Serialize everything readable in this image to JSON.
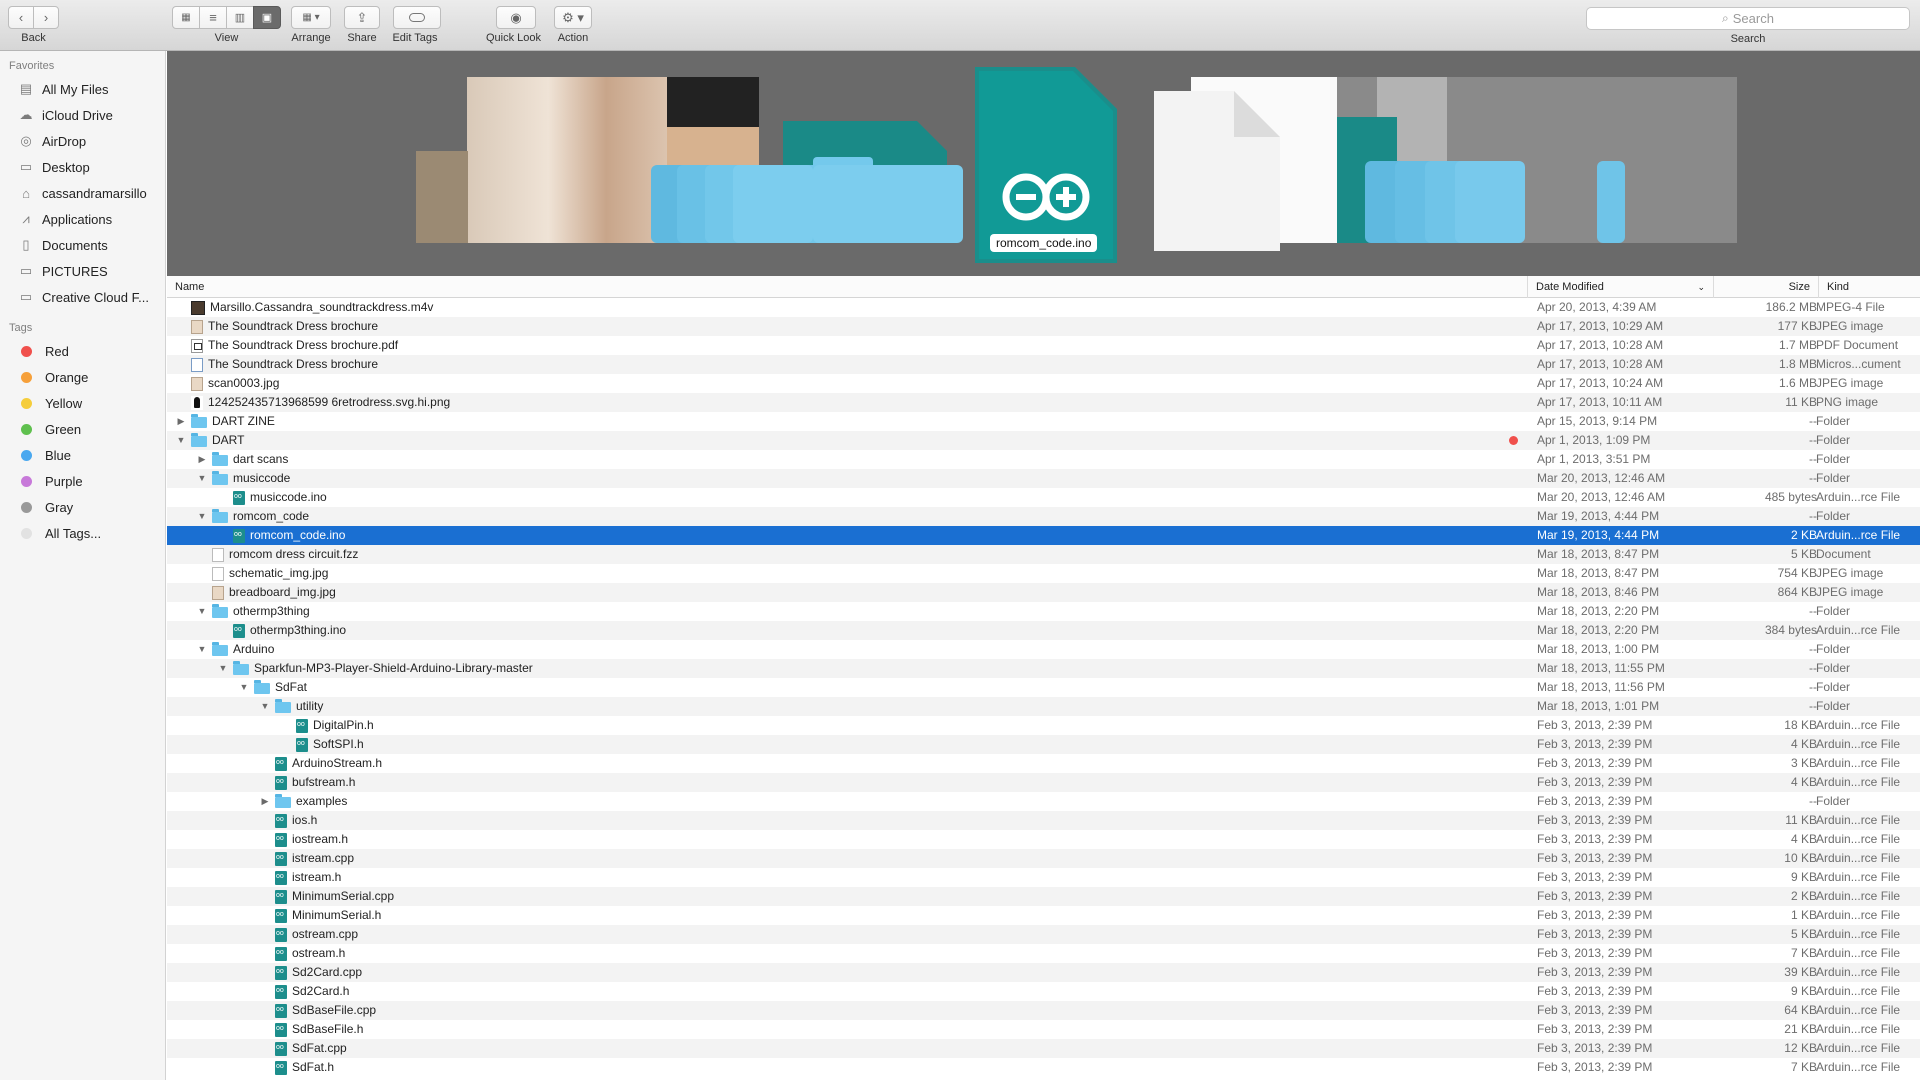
{
  "toolbar": {
    "back_label": "Back",
    "view_label": "View",
    "arrange_label": "Arrange",
    "share_label": "Share",
    "edit_tags_label": "Edit Tags",
    "quick_look_label": "Quick Look",
    "action_label": "Action",
    "search_placeholder": "Search",
    "search_label": "Search"
  },
  "sidebar": {
    "favorites_header": "Favorites",
    "favorites": [
      {
        "label": "All My Files",
        "icon": "all-files-icon"
      },
      {
        "label": "iCloud Drive",
        "icon": "cloud-icon"
      },
      {
        "label": "AirDrop",
        "icon": "airdrop-icon"
      },
      {
        "label": "Desktop",
        "icon": "desktop-icon"
      },
      {
        "label": "cassandramarsillo",
        "icon": "home-icon"
      },
      {
        "label": "Applications",
        "icon": "applications-icon"
      },
      {
        "label": "Documents",
        "icon": "documents-icon"
      },
      {
        "label": "PICTURES",
        "icon": "folder-icon"
      },
      {
        "label": "Creative Cloud F...",
        "icon": "folder-icon"
      }
    ],
    "tags_header": "Tags",
    "tags": [
      {
        "label": "Red",
        "color": "#f0504c"
      },
      {
        "label": "Orange",
        "color": "#f6a03a"
      },
      {
        "label": "Yellow",
        "color": "#f5cd3b"
      },
      {
        "label": "Green",
        "color": "#5fc04e"
      },
      {
        "label": "Blue",
        "color": "#4aa8ef"
      },
      {
        "label": "Purple",
        "color": "#c779d9"
      },
      {
        "label": "Gray",
        "color": "#999999"
      },
      {
        "label": "All Tags...",
        "color": "#e2e2e2"
      }
    ]
  },
  "coverflow": {
    "selected_caption": "romcom_code.ino"
  },
  "list": {
    "columns": {
      "name": "Name",
      "date": "Date Modified",
      "size": "Size",
      "kind": "Kind"
    },
    "rows": [
      {
        "name": "Marsillo.Cassandra_soundtrackdress.m4v",
        "date": "Apr 20, 2013, 4:39 AM",
        "size": "186.2 MB",
        "kind": "MPEG-4 File",
        "icon": "video",
        "level": 0,
        "disc": ""
      },
      {
        "name": "The Soundtrack Dress brochure",
        "date": "Apr 17, 2013, 10:29 AM",
        "size": "177 KB",
        "kind": "JPEG image",
        "icon": "img",
        "level": 0,
        "disc": ""
      },
      {
        "name": "The Soundtrack Dress brochure.pdf",
        "date": "Apr 17, 2013, 10:28 AM",
        "size": "1.7 MB",
        "kind": "PDF Document",
        "icon": "pdf",
        "level": 0,
        "disc": ""
      },
      {
        "name": "The Soundtrack Dress brochure",
        "date": "Apr 17, 2013, 10:28 AM",
        "size": "1.8 MB",
        "kind": "Micros...cument",
        "icon": "word",
        "level": 0,
        "disc": ""
      },
      {
        "name": "scan0003.jpg",
        "date": "Apr 17, 2013, 10:24 AM",
        "size": "1.6 MB",
        "kind": "JPEG image",
        "icon": "img",
        "level": 0,
        "disc": ""
      },
      {
        "name": "124252435713968599 6retrodress.svg.hi.png",
        "date": "Apr 17, 2013, 10:11 AM",
        "size": "11 KB",
        "kind": "PNG image",
        "icon": "png",
        "level": 0,
        "disc": ""
      },
      {
        "name": "DART ZINE",
        "date": "Apr 15, 2013, 9:14 PM",
        "size": "--",
        "kind": "Folder",
        "icon": "folder",
        "level": 0,
        "disc": "right"
      },
      {
        "name": "DART",
        "date": "Apr 1, 2013, 1:09 PM",
        "size": "--",
        "kind": "Folder",
        "icon": "folder",
        "level": 0,
        "disc": "down",
        "tag": "red"
      },
      {
        "name": "dart scans",
        "date": "Apr 1, 2013, 3:51 PM",
        "size": "--",
        "kind": "Folder",
        "icon": "folder",
        "level": 1,
        "disc": "right"
      },
      {
        "name": "musiccode",
        "date": "Mar 20, 2013, 12:46 AM",
        "size": "--",
        "kind": "Folder",
        "icon": "folder",
        "level": 1,
        "disc": "down"
      },
      {
        "name": "musiccode.ino",
        "date": "Mar 20, 2013, 12:46 AM",
        "size": "485 bytes",
        "kind": "Arduin...rce File",
        "icon": "ino",
        "level": 2,
        "disc": ""
      },
      {
        "name": "romcom_code",
        "date": "Mar 19, 2013, 4:44 PM",
        "size": "--",
        "kind": "Folder",
        "icon": "folder",
        "level": 1,
        "disc": "down"
      },
      {
        "name": "romcom_code.ino",
        "date": "Mar 19, 2013, 4:44 PM",
        "size": "2 KB",
        "kind": "Arduin...rce File",
        "icon": "ino",
        "level": 2,
        "disc": "",
        "selected": true
      },
      {
        "name": "romcom dress circuit.fzz",
        "date": "Mar 18, 2013, 8:47 PM",
        "size": "5 KB",
        "kind": "Document",
        "icon": "doc",
        "level": 1,
        "disc": ""
      },
      {
        "name": "schematic_img.jpg",
        "date": "Mar 18, 2013, 8:47 PM",
        "size": "754 KB",
        "kind": "JPEG image",
        "icon": "doc",
        "level": 1,
        "disc": ""
      },
      {
        "name": "breadboard_img.jpg",
        "date": "Mar 18, 2013, 8:46 PM",
        "size": "864 KB",
        "kind": "JPEG image",
        "icon": "img",
        "level": 1,
        "disc": ""
      },
      {
        "name": "othermp3thing",
        "date": "Mar 18, 2013, 2:20 PM",
        "size": "--",
        "kind": "Folder",
        "icon": "folder",
        "level": 1,
        "disc": "down"
      },
      {
        "name": "othermp3thing.ino",
        "date": "Mar 18, 2013, 2:20 PM",
        "size": "384 bytes",
        "kind": "Arduin...rce File",
        "icon": "ino",
        "level": 2,
        "disc": ""
      },
      {
        "name": "Arduino",
        "date": "Mar 18, 2013, 1:00 PM",
        "size": "--",
        "kind": "Folder",
        "icon": "folder",
        "level": 1,
        "disc": "down"
      },
      {
        "name": "Sparkfun-MP3-Player-Shield-Arduino-Library-master",
        "date": "Mar 18, 2013, 11:55 PM",
        "size": "--",
        "kind": "Folder",
        "icon": "folder",
        "level": 2,
        "disc": "down"
      },
      {
        "name": "SdFat",
        "date": "Mar 18, 2013, 11:56 PM",
        "size": "--",
        "kind": "Folder",
        "icon": "folder",
        "level": 3,
        "disc": "down"
      },
      {
        "name": "utility",
        "date": "Mar 18, 2013, 1:01 PM",
        "size": "--",
        "kind": "Folder",
        "icon": "folder",
        "level": 4,
        "disc": "down"
      },
      {
        "name": "DigitalPin.h",
        "date": "Feb 3, 2013, 2:39 PM",
        "size": "18 KB",
        "kind": "Arduin...rce File",
        "icon": "ino",
        "level": 5,
        "disc": ""
      },
      {
        "name": "SoftSPI.h",
        "date": "Feb 3, 2013, 2:39 PM",
        "size": "4 KB",
        "kind": "Arduin...rce File",
        "icon": "ino",
        "level": 5,
        "disc": ""
      },
      {
        "name": "ArduinoStream.h",
        "date": "Feb 3, 2013, 2:39 PM",
        "size": "3 KB",
        "kind": "Arduin...rce File",
        "icon": "ino",
        "level": 4,
        "disc": ""
      },
      {
        "name": "bufstream.h",
        "date": "Feb 3, 2013, 2:39 PM",
        "size": "4 KB",
        "kind": "Arduin...rce File",
        "icon": "ino",
        "level": 4,
        "disc": ""
      },
      {
        "name": "examples",
        "date": "Feb 3, 2013, 2:39 PM",
        "size": "--",
        "kind": "Folder",
        "icon": "folder",
        "level": 4,
        "disc": "right"
      },
      {
        "name": "ios.h",
        "date": "Feb 3, 2013, 2:39 PM",
        "size": "11 KB",
        "kind": "Arduin...rce File",
        "icon": "ino",
        "level": 4,
        "disc": ""
      },
      {
        "name": "iostream.h",
        "date": "Feb 3, 2013, 2:39 PM",
        "size": "4 KB",
        "kind": "Arduin...rce File",
        "icon": "ino",
        "level": 4,
        "disc": ""
      },
      {
        "name": "istream.cpp",
        "date": "Feb 3, 2013, 2:39 PM",
        "size": "10 KB",
        "kind": "Arduin...rce File",
        "icon": "ino",
        "level": 4,
        "disc": ""
      },
      {
        "name": "istream.h",
        "date": "Feb 3, 2013, 2:39 PM",
        "size": "9 KB",
        "kind": "Arduin...rce File",
        "icon": "ino",
        "level": 4,
        "disc": ""
      },
      {
        "name": "MinimumSerial.cpp",
        "date": "Feb 3, 2013, 2:39 PM",
        "size": "2 KB",
        "kind": "Arduin...rce File",
        "icon": "ino",
        "level": 4,
        "disc": ""
      },
      {
        "name": "MinimumSerial.h",
        "date": "Feb 3, 2013, 2:39 PM",
        "size": "1 KB",
        "kind": "Arduin...rce File",
        "icon": "ino",
        "level": 4,
        "disc": ""
      },
      {
        "name": "ostream.cpp",
        "date": "Feb 3, 2013, 2:39 PM",
        "size": "5 KB",
        "kind": "Arduin...rce File",
        "icon": "ino",
        "level": 4,
        "disc": ""
      },
      {
        "name": "ostream.h",
        "date": "Feb 3, 2013, 2:39 PM",
        "size": "7 KB",
        "kind": "Arduin...rce File",
        "icon": "ino",
        "level": 4,
        "disc": ""
      },
      {
        "name": "Sd2Card.cpp",
        "date": "Feb 3, 2013, 2:39 PM",
        "size": "39 KB",
        "kind": "Arduin...rce File",
        "icon": "ino",
        "level": 4,
        "disc": ""
      },
      {
        "name": "Sd2Card.h",
        "date": "Feb 3, 2013, 2:39 PM",
        "size": "9 KB",
        "kind": "Arduin...rce File",
        "icon": "ino",
        "level": 4,
        "disc": ""
      },
      {
        "name": "SdBaseFile.cpp",
        "date": "Feb 3, 2013, 2:39 PM",
        "size": "64 KB",
        "kind": "Arduin...rce File",
        "icon": "ino",
        "level": 4,
        "disc": ""
      },
      {
        "name": "SdBaseFile.h",
        "date": "Feb 3, 2013, 2:39 PM",
        "size": "21 KB",
        "kind": "Arduin...rce File",
        "icon": "ino",
        "level": 4,
        "disc": ""
      },
      {
        "name": "SdFat.cpp",
        "date": "Feb 3, 2013, 2:39 PM",
        "size": "12 KB",
        "kind": "Arduin...rce File",
        "icon": "ino",
        "level": 4,
        "disc": ""
      },
      {
        "name": "SdFat.h",
        "date": "Feb 3, 2013, 2:39 PM",
        "size": "7 KB",
        "kind": "Arduin...rce File",
        "icon": "ino",
        "level": 4,
        "disc": ""
      }
    ]
  }
}
